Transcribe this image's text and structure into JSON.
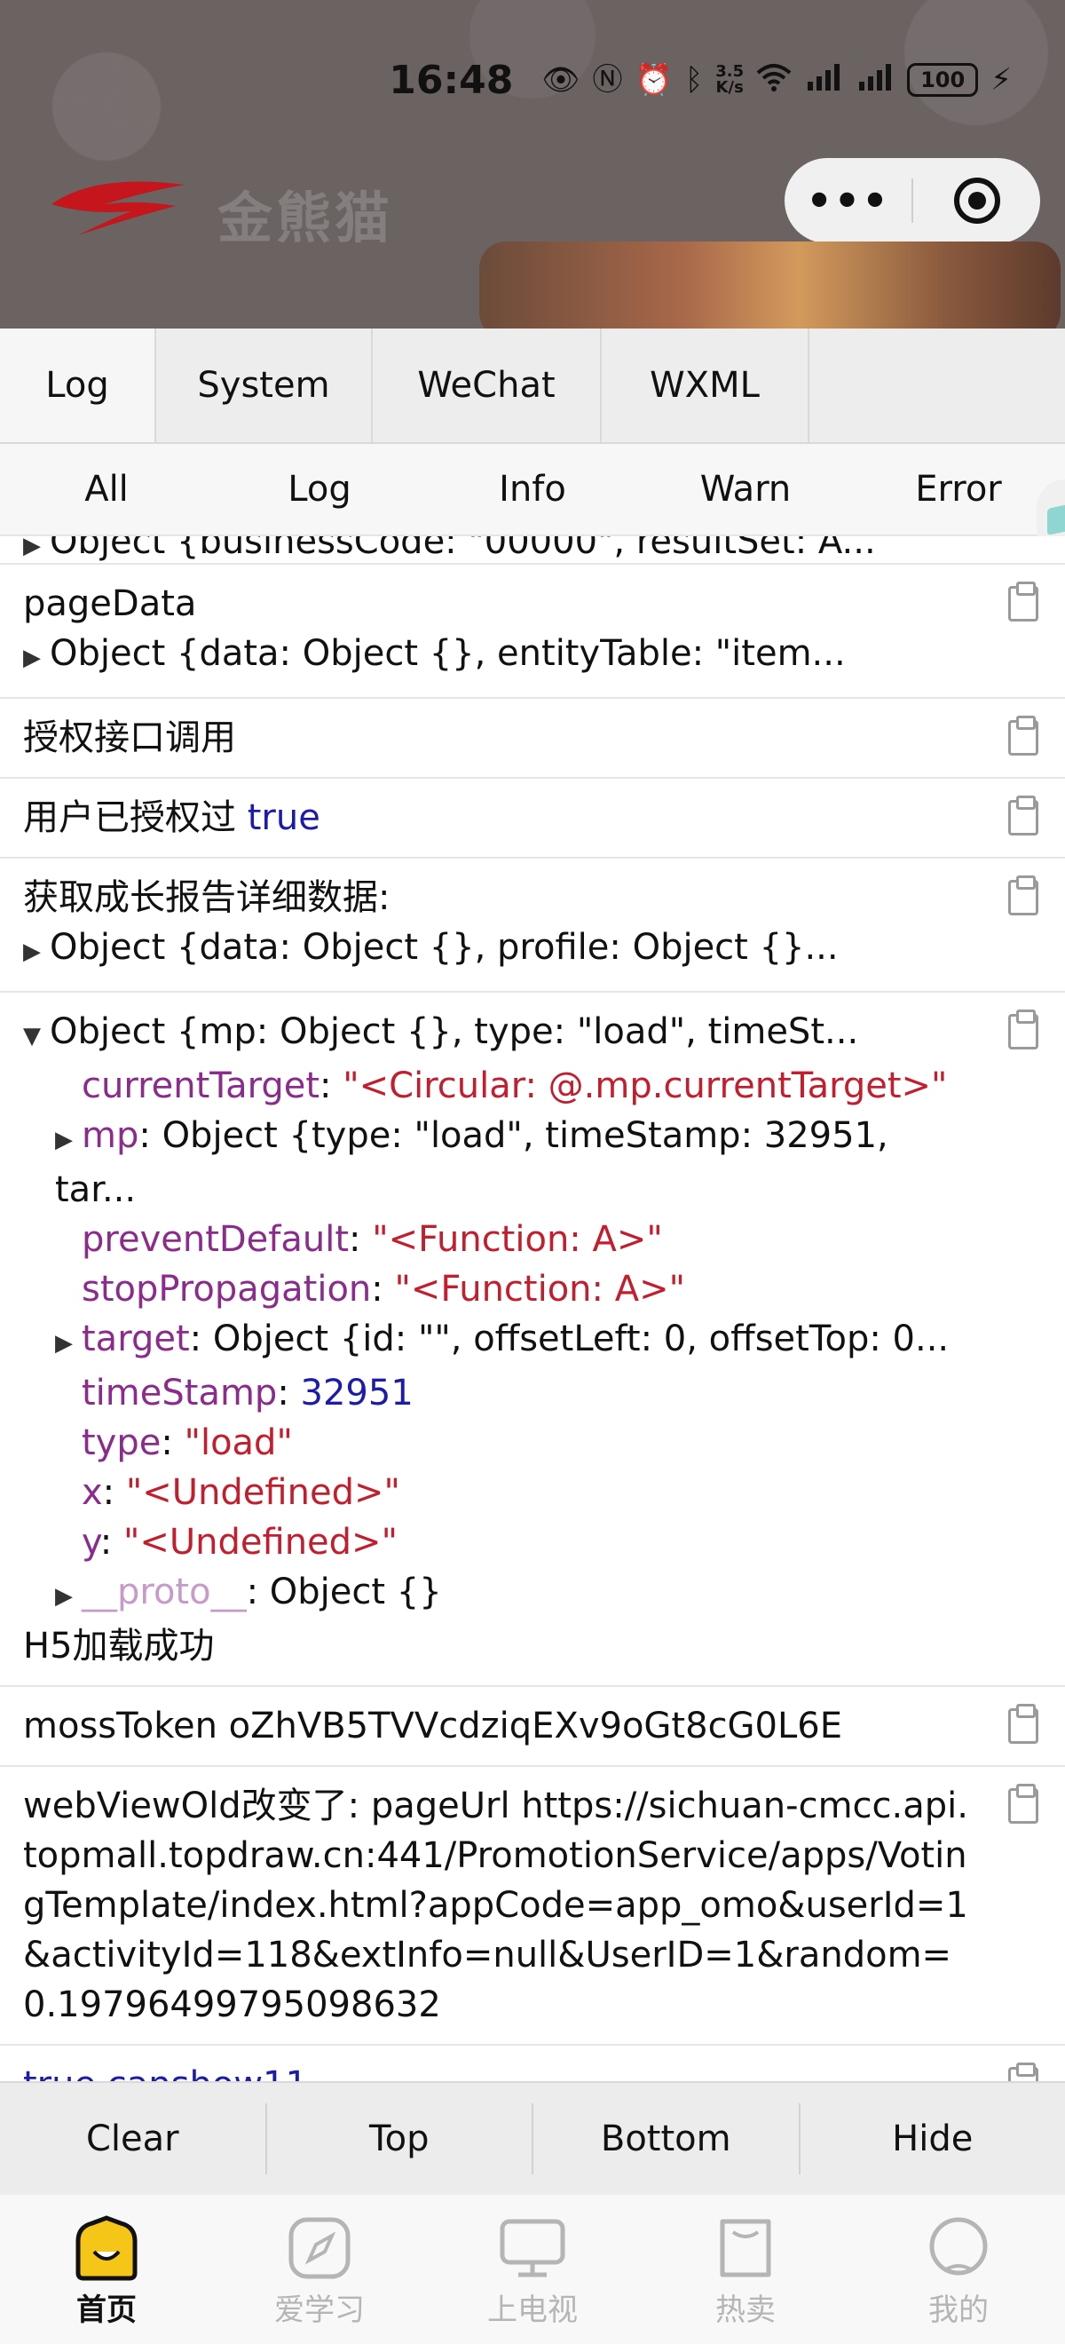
{
  "status_bar": {
    "time": "16:48",
    "speed_value": "3.5",
    "speed_unit": "K/s",
    "battery": "100"
  },
  "header": {
    "logo_text": "金熊猫",
    "colors": {
      "background": "#6b6262",
      "logo_red": "#c4161c"
    }
  },
  "vconsole": {
    "tabs": [
      "Log",
      "System",
      "WeChat",
      "WXML"
    ],
    "active_tab": "Log",
    "filters": [
      "All",
      "Log",
      "Info",
      "Warn",
      "Error"
    ],
    "active_filter": "All",
    "logs": {
      "partial_top": "Object {businessCode: \"00000\", resultSet: A...",
      "page_data_label": "pageData",
      "page_data_obj": "Object {data: Object {}, entityTable: \"item...",
      "auth_call": "授权接口调用",
      "authorized_text": "用户已授权过",
      "authorized_value": "true",
      "growth_label": "获取成长报告详细数据:",
      "growth_obj": "Object {data: Object {}, profile: Object {}...",
      "event_obj": "Object {mp: Object {}, type: \"load\", timeSt...",
      "event_props": {
        "current_target_key": "currentTarget",
        "current_target_val": "\"<Circular: @.mp.currentTarget>\"",
        "mp_key": "mp",
        "mp_val": "Object {type: \"load\", timeStamp: 32951, tar...",
        "prevent_key": "preventDefault",
        "prevent_val": "\"<Function: A>\"",
        "stop_key": "stopPropagation",
        "stop_val": "\"<Function: A>\"",
        "target_key": "target",
        "target_val": "Object {id: \"\", offsetLeft: 0, offsetTop: 0...",
        "timestamp_key": "timeStamp",
        "timestamp_val": "32951",
        "type_key": "type",
        "type_val": "\"load\"",
        "x_key": "x",
        "x_val": "\"<Undefined>\"",
        "y_key": "y",
        "y_val": "\"<Undefined>\"",
        "proto_key": "__proto__",
        "proto_val": "Object {}"
      },
      "h5_loaded": "H5加载成功",
      "moss_token": "mossToken oZhVB5TVVcdziqEXv9oGt8cG0L6E",
      "webview_changed": "webViewOld改变了:  pageUrl https://sichuan-cmcc.api.topmall.topdraw.cn:441/PromotionService/apps/VotingTemplate/index.html?appCode=app_omo&userId=1&activityId=118&extInfo=null&UserID=1&random=0.19796499795098632",
      "partial_bottom": "true canshow11"
    },
    "toolbar": [
      "Clear",
      "Top",
      "Bottom",
      "Hide"
    ],
    "colors": {
      "key": "#8b2b8b",
      "string": "#c21e2d",
      "number": "#1c1ca8"
    }
  },
  "bottom_nav": {
    "items": [
      {
        "label": "首页",
        "icon": "home-icon"
      },
      {
        "label": "爱学习",
        "icon": "compass-icon"
      },
      {
        "label": "上电视",
        "icon": "tv-icon"
      },
      {
        "label": "热卖",
        "icon": "shopping-bag-icon"
      },
      {
        "label": "我的",
        "icon": "profile-icon"
      }
    ],
    "active_index": 0,
    "colors": {
      "active_icon": "#f5c518",
      "inactive": "#b5b5b5"
    }
  }
}
